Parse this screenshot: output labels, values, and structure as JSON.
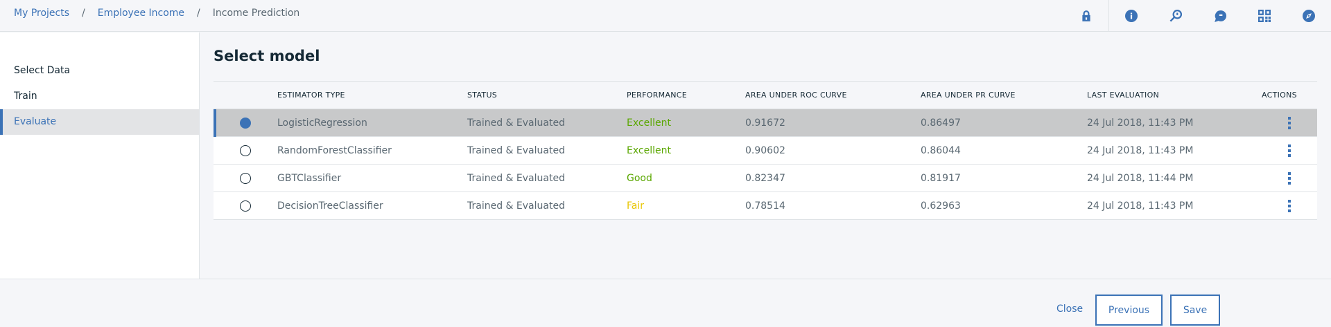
{
  "breadcrumb": {
    "items": [
      "My Projects",
      "Employee Income"
    ],
    "separator": "/",
    "current": "Income Prediction"
  },
  "header_icons": [
    "lock-icon",
    "info-icon",
    "search-model-icon",
    "chat-icon",
    "grid-icon",
    "compass-icon"
  ],
  "sidebar": {
    "items": [
      {
        "label": "Select Data"
      },
      {
        "label": "Train"
      },
      {
        "label": "Evaluate",
        "active": true
      }
    ]
  },
  "main": {
    "title": "Select model",
    "table": {
      "headers": [
        "ESTIMATOR TYPE",
        "STATUS",
        "PERFORMANCE",
        "AREA UNDER ROC CURVE",
        "AREA UNDER PR CURVE",
        "LAST EVALUATION",
        "ACTIONS"
      ],
      "rows": [
        {
          "type": "LogisticRegression",
          "status": "Trained & Evaluated",
          "performance": "Excellent",
          "roc": "0.91672",
          "pr": "0.86497",
          "evaluated": "24 Jul 2018, 11:43 PM",
          "selected": true
        },
        {
          "type": "RandomForestClassifier",
          "status": "Trained & Evaluated",
          "performance": "Excellent",
          "roc": "0.90602",
          "pr": "0.86044",
          "evaluated": "24 Jul 2018, 11:43 PM",
          "selected": false
        },
        {
          "type": "GBTClassifier",
          "status": "Trained & Evaluated",
          "performance": "Good",
          "roc": "0.82347",
          "pr": "0.81917",
          "evaluated": "24 Jul 2018, 11:44 PM",
          "selected": false
        },
        {
          "type": "DecisionTreeClassifier",
          "status": "Trained & Evaluated",
          "performance": "Fair",
          "roc": "0.78514",
          "pr": "0.62963",
          "evaluated": "24 Jul 2018, 11:43 PM",
          "selected": false
        }
      ]
    }
  },
  "footer": {
    "close_label": "Close",
    "previous_label": "Previous",
    "save_label": "Save"
  },
  "colors": {
    "accent": "#3b72b6",
    "excellent": "#5aa700",
    "good": "#5aa700",
    "fair": "#e8c600"
  }
}
